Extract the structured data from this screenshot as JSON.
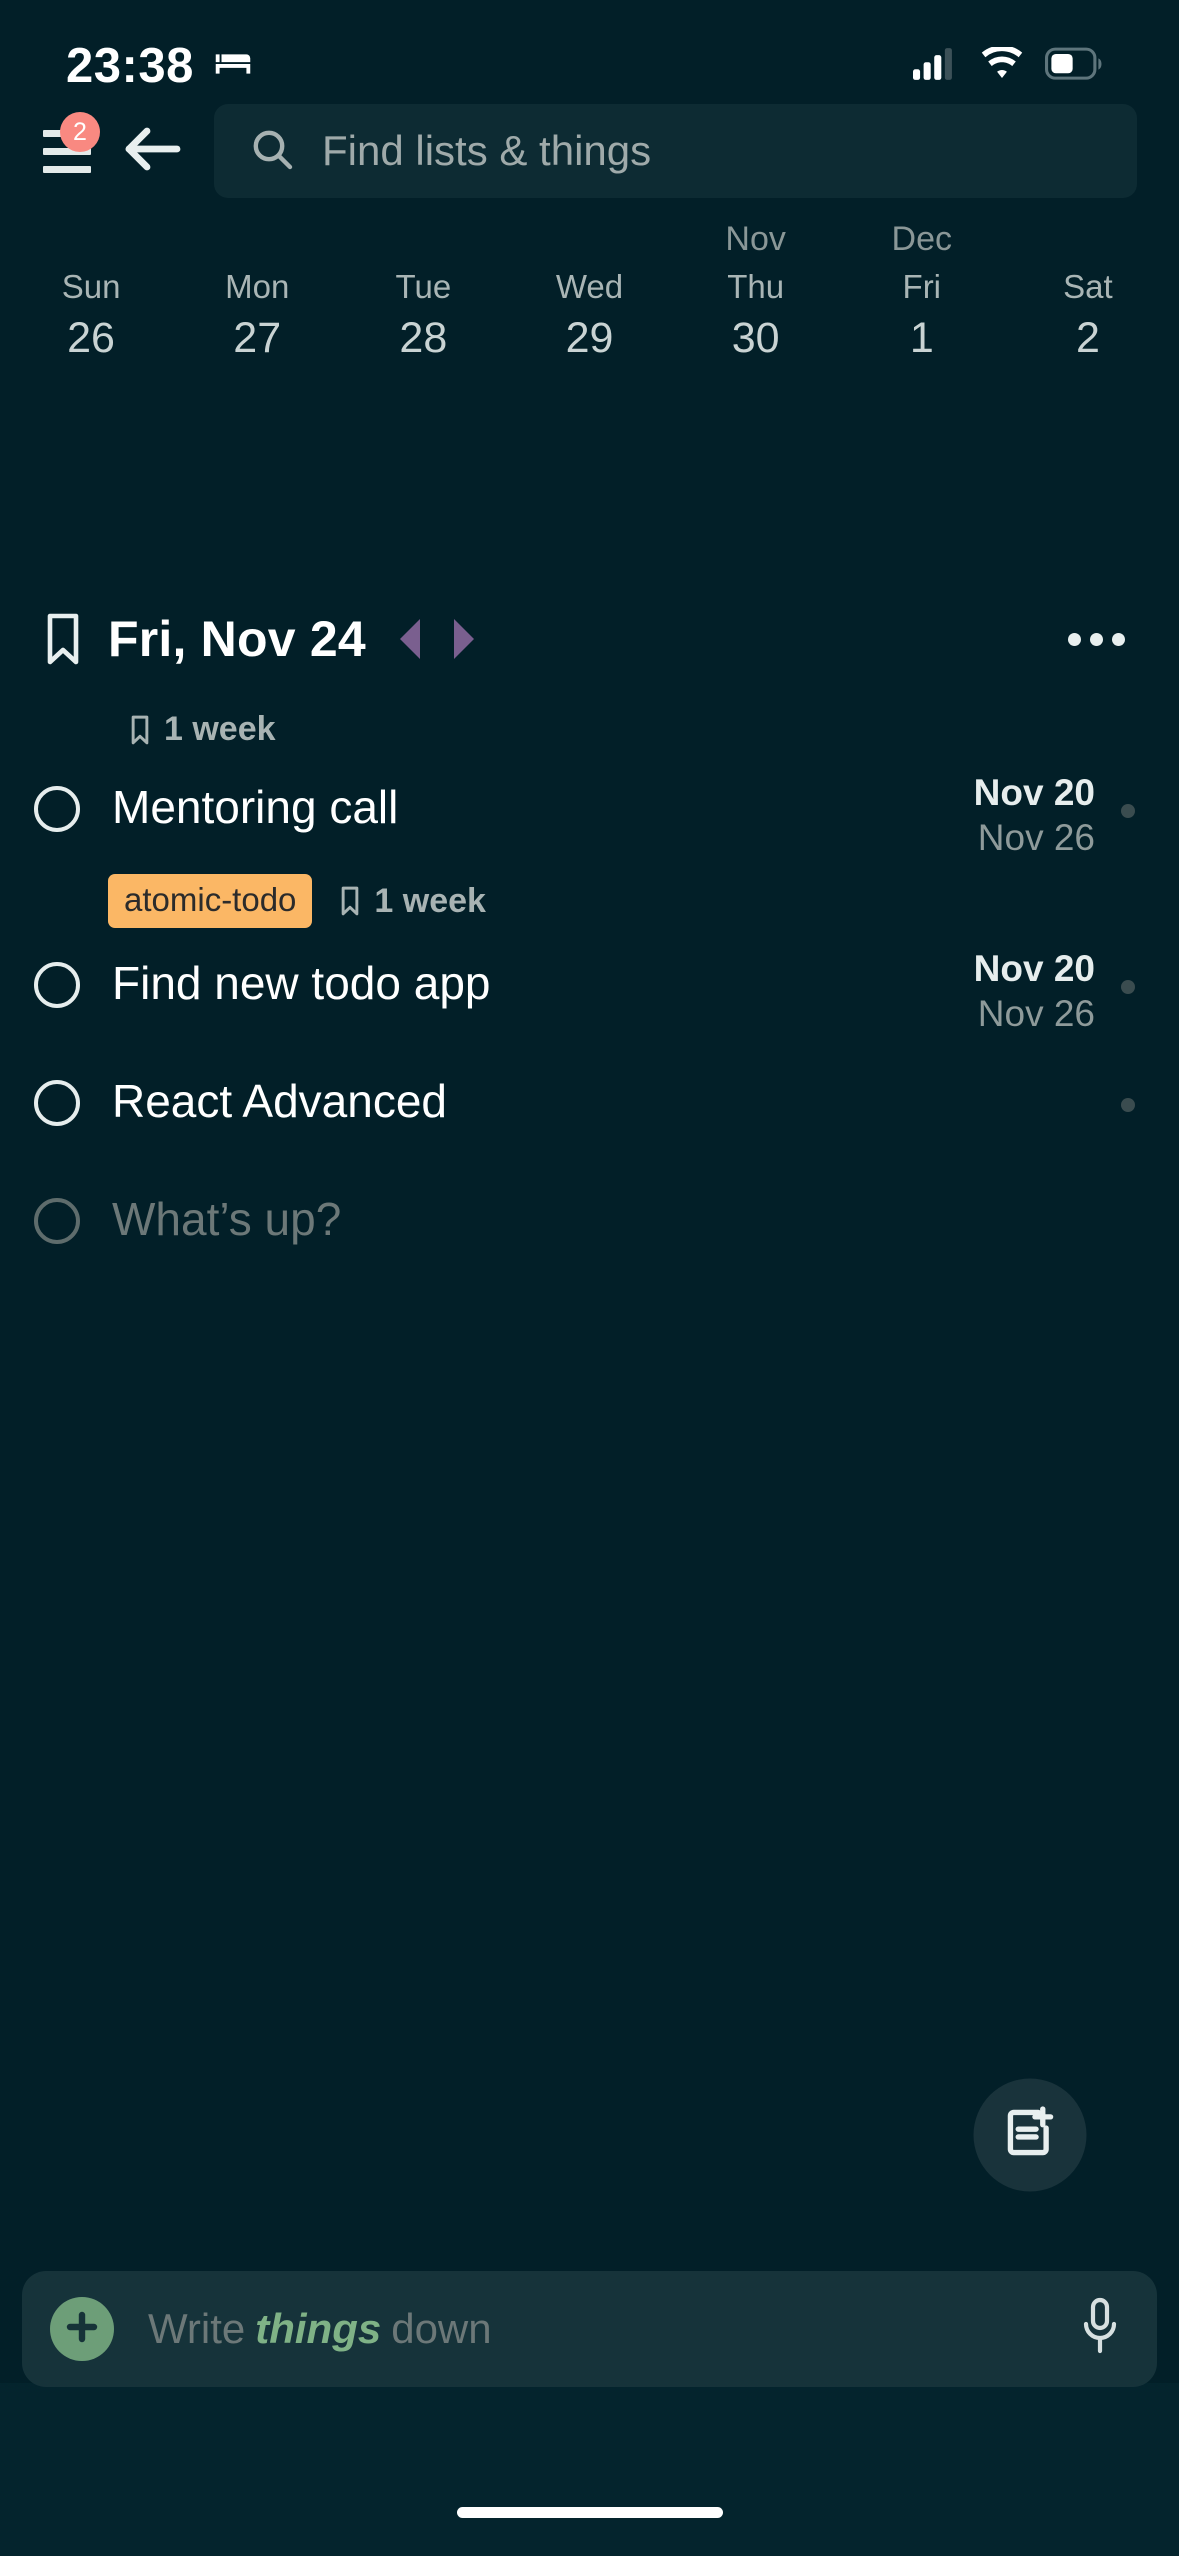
{
  "status_bar": {
    "time": "23:38",
    "sleep_icon": "bed-icon",
    "signal_icon": "cellular-signal-icon",
    "wifi_icon": "wifi-icon",
    "battery_icon": "battery-icon"
  },
  "top_bar": {
    "menu_icon": "hamburger-menu-icon",
    "menu_badge_count": "2",
    "back_icon": "back-arrow-icon",
    "search": {
      "icon": "search-icon",
      "placeholder": "Find lists & things",
      "value": ""
    }
  },
  "week_strip": {
    "days": [
      {
        "month": "",
        "name": "Sun",
        "num": "26"
      },
      {
        "month": "",
        "name": "Mon",
        "num": "27"
      },
      {
        "month": "",
        "name": "Tue",
        "num": "28"
      },
      {
        "month": "",
        "name": "Wed",
        "num": "29"
      },
      {
        "month": "Nov",
        "name": "Thu",
        "num": "30"
      },
      {
        "month": "Dec",
        "name": "Fri",
        "num": "1"
      },
      {
        "month": "",
        "name": "Sat",
        "num": "2"
      }
    ]
  },
  "date_header": {
    "bookmark_icon": "bookmark-icon",
    "title": "Fri, Nov 24",
    "prev_icon": "previous-day-triangle-icon",
    "next_icon": "next-day-triangle-icon",
    "more_icon": "more-options-icon",
    "subtitle": "1 week",
    "subtitle_icon": "bookmark-icon"
  },
  "tasks": [
    {
      "title": "Mentoring call",
      "checked": false,
      "muted": false,
      "date_start": "Nov 20",
      "date_end": "Nov 26",
      "has_dot": true,
      "tag": "atomic-todo",
      "tag_meta": "1 week"
    },
    {
      "title": "Find new todo app",
      "checked": false,
      "muted": false,
      "date_start": "Nov 20",
      "date_end": "Nov 26",
      "has_dot": true,
      "tag": "",
      "tag_meta": ""
    },
    {
      "title": "React Advanced",
      "checked": false,
      "muted": false,
      "date_start": "",
      "date_end": "",
      "has_dot": true,
      "tag": "",
      "tag_meta": ""
    },
    {
      "title": "What’s up?",
      "checked": false,
      "muted": true,
      "date_start": "",
      "date_end": "",
      "has_dot": false,
      "tag": "",
      "tag_meta": ""
    }
  ],
  "fab": {
    "icon": "new-note-icon"
  },
  "composer": {
    "add_icon": "plus-icon",
    "placeholder_prefix": "Write ",
    "placeholder_accent": "things",
    "placeholder_suffix": " down",
    "value": "",
    "mic_icon": "microphone-icon"
  },
  "colors": {
    "background": "#021F28",
    "surface": "#0D2B33",
    "badge": "#F98981",
    "tag": "#FBB765",
    "accent_green": "#6D9E78",
    "arrow_purple": "#7A5F8F"
  }
}
